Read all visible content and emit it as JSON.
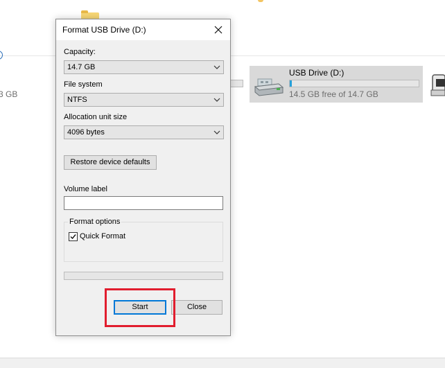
{
  "dialog": {
    "title": "Format USB Drive (D:)",
    "capacity": {
      "label": "Capacity:",
      "value": "14.7 GB"
    },
    "file_system": {
      "label": "File system",
      "value": "NTFS"
    },
    "allocation": {
      "label": "Allocation unit size",
      "value": "4096 bytes"
    },
    "restore_label": "Restore device defaults",
    "volume_label": {
      "label": "Volume label",
      "value": ""
    },
    "format_options": {
      "title": "Format options",
      "quick_format_label": "Quick Format",
      "quick_format_checked": true
    },
    "progress_fraction": 0,
    "start_label": "Start",
    "close_label": "Close"
  },
  "explorer": {
    "left_drive_size_fragment": "3 GB",
    "usb_drive": {
      "name": "USB Drive (D:)",
      "free_text": "14.5 GB free of 14.7 GB",
      "used_fraction": 0.014
    }
  },
  "colors": {
    "highlight": "#e11d2e",
    "accent": "#0078d7",
    "usage_bar": "#26a0da",
    "dialog_bg": "#f0f0f0"
  }
}
